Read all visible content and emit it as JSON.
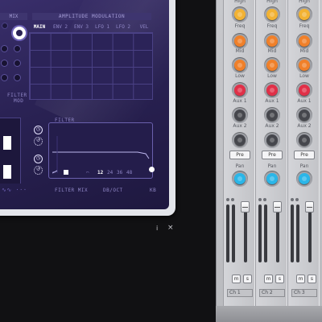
{
  "synth": {
    "mix_header": "MIX",
    "amp_mod_header": "AMPLITUDE MODULATION",
    "tabs": [
      "MAIN",
      "ENV 2",
      "ENV 3",
      "LFO 1",
      "LFO 2",
      "VEL"
    ],
    "active_tab": "MAIN",
    "filter_mod_label_1": "FILTER",
    "filter_mod_label_2": "MOD",
    "filter_label": "FILTER",
    "filter_mix_label": "FILTER MIX",
    "dboct_label": "DB/OCT",
    "kb_label": "KB",
    "dboct_options": [
      "12",
      "24",
      "36",
      "48"
    ],
    "dboct_selected": "12",
    "accent_color": "#ffffff",
    "panel_color": "#2a2254"
  },
  "window_controls": {
    "info_label": "i",
    "close_label": "×"
  },
  "mixer": {
    "row_labels": [
      "High",
      "Freq",
      "Mid",
      "Low",
      "Aux 1",
      "Aux 2",
      "Pan"
    ],
    "pre_label": "Pre",
    "m_label": "m",
    "s_label": "s",
    "channels": [
      {
        "name": "Ch 1"
      },
      {
        "name": "Ch 2"
      },
      {
        "name": "Ch 3"
      }
    ],
    "knob_colors": {
      "High": "#f2b233",
      "Freq": "#f0802a",
      "Mid": "#f0802a",
      "Low": "#e03048",
      "Aux 1": "#46474d",
      "Aux 2": "#46474d",
      "Pan": "#2ab6e8"
    }
  }
}
